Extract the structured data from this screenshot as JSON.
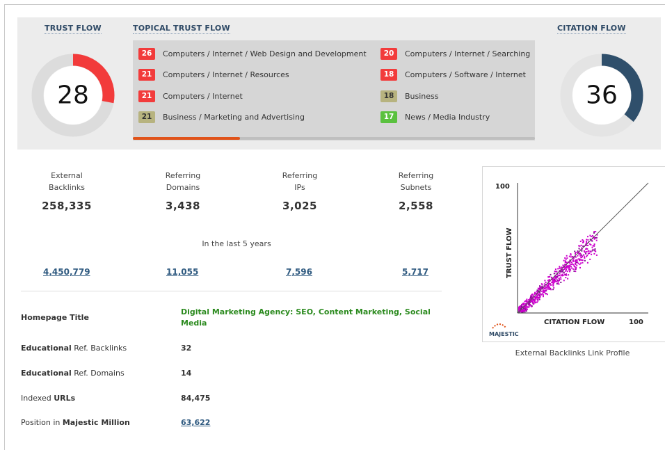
{
  "trust_flow": {
    "title": "TRUST FLOW",
    "value": "28",
    "color": "#f23b3b"
  },
  "citation_flow": {
    "title": "CITATION FLOW",
    "value": "36",
    "color": "#2f4f6b"
  },
  "topical_trust_flow": {
    "title": "TOPICAL TRUST FLOW",
    "items": [
      {
        "score": "26",
        "label": "Computers / Internet / Web Design and Development",
        "color": "#f23b3b"
      },
      {
        "score": "21",
        "label": "Computers / Internet / Resources",
        "color": "#f23b3b"
      },
      {
        "score": "21",
        "label": "Computers / Internet",
        "color": "#f23b3b"
      },
      {
        "score": "21",
        "label": "Business / Marketing and Advertising",
        "color": "#b7b37f"
      },
      {
        "score": "20",
        "label": "Computers / Internet / Searching",
        "color": "#f23b3b"
      },
      {
        "score": "18",
        "label": "Computers / Software / Internet",
        "color": "#f23b3b"
      },
      {
        "score": "18",
        "label": "Business",
        "color": "#b7b37f"
      },
      {
        "score": "17",
        "label": "News / Media Industry",
        "color": "#5ac13f"
      }
    ]
  },
  "stats": [
    {
      "label": "External\nBacklinks",
      "value": "258,335",
      "history": "4,450,779"
    },
    {
      "label": "Referring\nDomains",
      "value": "3,438",
      "history": "11,055"
    },
    {
      "label": "Referring\nIPs",
      "value": "3,025",
      "history": "7,596"
    },
    {
      "label": "Referring\nSubnets",
      "value": "2,558",
      "history": "5,717"
    }
  ],
  "period_label": "In the last 5 years",
  "info": {
    "homepage_title_label": "Homepage Title",
    "homepage_title_value": "Digital Marketing Agency: SEO, Content Marketing, Social Media",
    "edu_backlinks_label_bold": "Educational",
    "edu_backlinks_label_rest": " Ref. Backlinks",
    "edu_backlinks_value": "32",
    "edu_domains_label_bold": "Educational",
    "edu_domains_label_rest": " Ref. Domains",
    "edu_domains_value": "14",
    "indexed_label_plain": "Indexed ",
    "indexed_label_bold": "URLs",
    "indexed_value": "84,475",
    "position_label_plain": "Position in ",
    "position_label_bold": "Majestic Million",
    "position_value": "63,622"
  },
  "link_profile": {
    "y_axis_label": "TRUST FLOW",
    "x_axis_label": "CITATION FLOW",
    "y_max_label": "100",
    "x_max_label": "100",
    "logo_text": "MAJESTIC",
    "caption": "External Backlinks Link Profile",
    "point_color": "#cc00cc"
  }
}
